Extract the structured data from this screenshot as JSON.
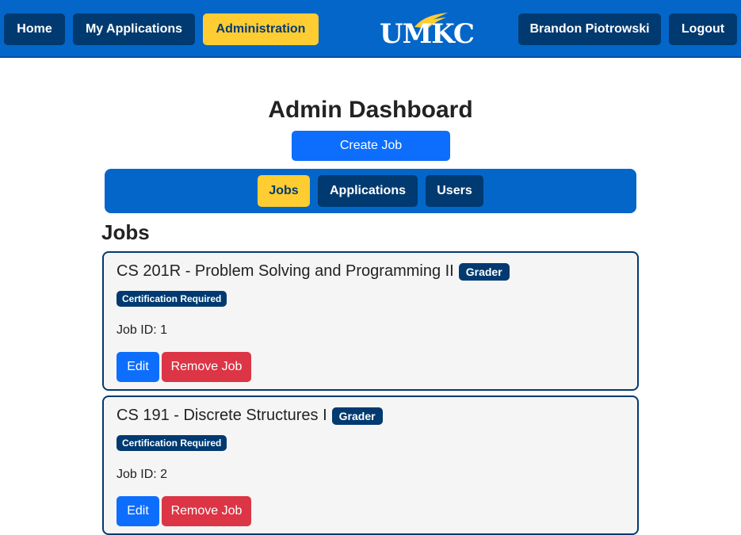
{
  "nav": {
    "home": "Home",
    "my_applications": "My Applications",
    "administration": "Administration",
    "logo_text": "UMKC",
    "user_name": "Brandon Piotrowski",
    "logout": "Logout"
  },
  "page": {
    "title": "Admin Dashboard",
    "create_job": "Create Job"
  },
  "tabs": [
    {
      "label": "Jobs",
      "active": true
    },
    {
      "label": "Applications",
      "active": false
    },
    {
      "label": "Users",
      "active": false
    }
  ],
  "section_title": "Jobs",
  "jobs": [
    {
      "title": "CS 201R - Problem Solving and Programming II",
      "role_badge": "Grader",
      "cert_badge": "Certification Required",
      "job_id": "Job ID: 1",
      "edit_label": "Edit",
      "remove_label": "Remove Job"
    },
    {
      "title": "CS 191 - Discrete Structures I",
      "role_badge": "Grader",
      "cert_badge": "Certification Required",
      "job_id": "Job ID: 2",
      "edit_label": "Edit",
      "remove_label": "Remove Job"
    }
  ],
  "colors": {
    "nav_blue": "#0466c8",
    "navy": "#003a70",
    "gold": "#ffcd32",
    "primary": "#0d6efd",
    "danger": "#dc3545"
  }
}
